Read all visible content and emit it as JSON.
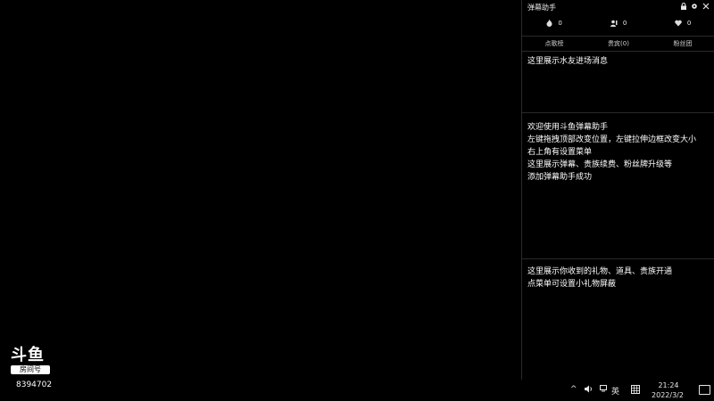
{
  "logo": {
    "mark": "斗鱼",
    "sub": "房间号",
    "room_id": "8394702"
  },
  "panel": {
    "title": "弹幕助手",
    "stats": [
      {
        "icon": "fire-icon",
        "value": "0"
      },
      {
        "icon": "users-icon",
        "value": "0"
      },
      {
        "icon": "heart-icon",
        "value": "0"
      }
    ],
    "tabs": [
      "点歌榜",
      "贵宾(0)",
      "粉丝团"
    ],
    "section1": [
      "这里展示水友进场消息"
    ],
    "section2": [
      "欢迎使用斗鱼弹幕助手",
      "左键拖拽顶部改变位置，左键拉伸边框改变大小",
      "右上角有设置菜单",
      "这里展示弹幕、贵族续费、粉丝牌升级等",
      "添加弹幕助手成功"
    ],
    "section3": [
      "这里展示你收到的礼物、道具、贵族开通",
      "点菜单可设置小礼物屏蔽"
    ]
  },
  "taskbar": {
    "chevron": "^",
    "lang": "英",
    "time": "21:24",
    "date": "2022/3/2"
  }
}
